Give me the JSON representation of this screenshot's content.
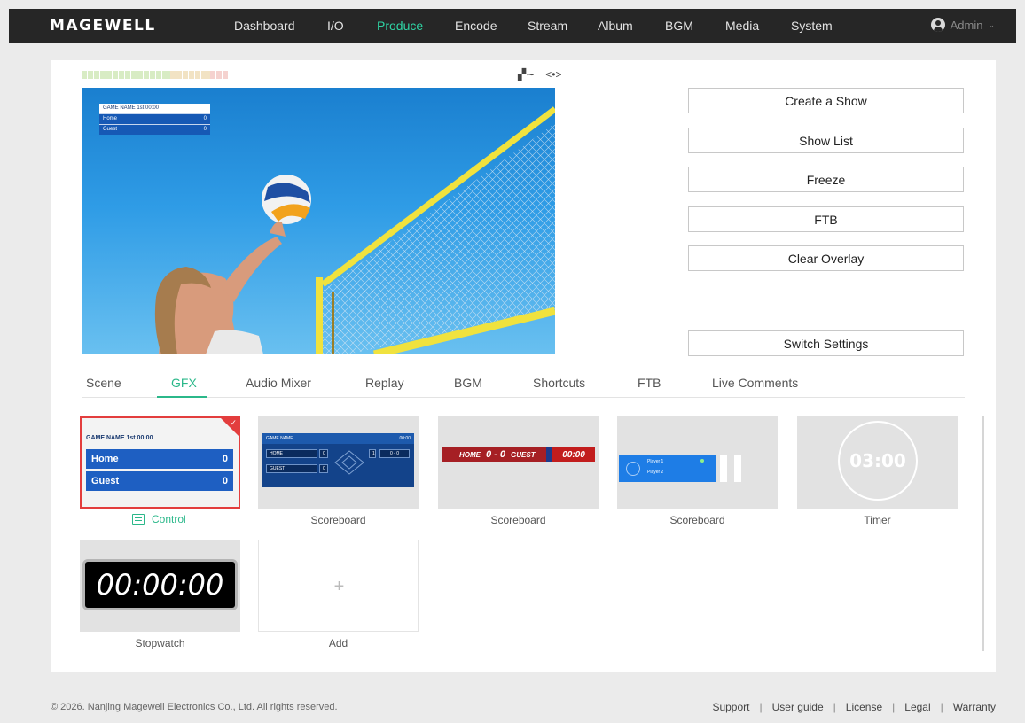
{
  "brand": {
    "logo": "MAGEWELL"
  },
  "nav": [
    {
      "label": "Dashboard"
    },
    {
      "label": "I/O"
    },
    {
      "label": "Produce"
    },
    {
      "label": "Encode"
    },
    {
      "label": "Stream"
    },
    {
      "label": "Album"
    },
    {
      "label": "BGM"
    },
    {
      "label": "Media"
    },
    {
      "label": "System"
    }
  ],
  "nav_active": "Produce",
  "user": {
    "name": "Admin"
  },
  "preview": {
    "overlay_title": "GAME NAME  1st  00:00",
    "home_label": "Home",
    "home_score": "0",
    "guest_label": "Guest",
    "guest_score": "0"
  },
  "actions": {
    "create_show": "Create a Show",
    "show_list": "Show List",
    "freeze": "Freeze",
    "ftb": "FTB",
    "clear_overlay": "Clear Overlay",
    "switch_settings": "Switch Settings"
  },
  "tabs": [
    {
      "label": "Scene"
    },
    {
      "label": "GFX"
    },
    {
      "label": "Audio Mixer"
    },
    {
      "label": "Replay"
    },
    {
      "label": "BGM"
    },
    {
      "label": "Shortcuts"
    },
    {
      "label": "FTB"
    },
    {
      "label": "Live Comments"
    }
  ],
  "active_tab": "GFX",
  "gfx": {
    "card1": {
      "title": "GAME NAME  1st  00:00",
      "home": "Home",
      "home_score": "0",
      "guest": "Guest",
      "guest_score": "0",
      "label": "Control"
    },
    "card2": {
      "title": "GAME NAME",
      "time": "00:00",
      "home": "HOME",
      "guest": "GUEST",
      "home_score": "0",
      "guest_score": "0",
      "period": "1",
      "count": "0 - 0",
      "label": "Scoreboard"
    },
    "card3": {
      "home": "HOME",
      "score": "0 - 0",
      "guest": "GUEST",
      "time": "00:00",
      "label": "Scoreboard"
    },
    "card4": {
      "player1": "Player 1",
      "player2": "Player 2",
      "label": "Scoreboard"
    },
    "card5": {
      "time": "03:00",
      "label": "Timer"
    },
    "card6": {
      "time": "00:00:00",
      "label": "Stopwatch"
    },
    "card7": {
      "label": "Add"
    }
  },
  "footer": {
    "copyright": "© 2026. Nanjing Magewell Electronics Co., Ltd. All rights reserved.",
    "links": [
      {
        "label": "Support"
      },
      {
        "label": "User guide"
      },
      {
        "label": "License"
      },
      {
        "label": "Legal"
      },
      {
        "label": "Warranty"
      }
    ]
  },
  "colors": {
    "accent": "#2bb88a",
    "selected_border": "#e33d3d",
    "topbar": "#262626"
  }
}
